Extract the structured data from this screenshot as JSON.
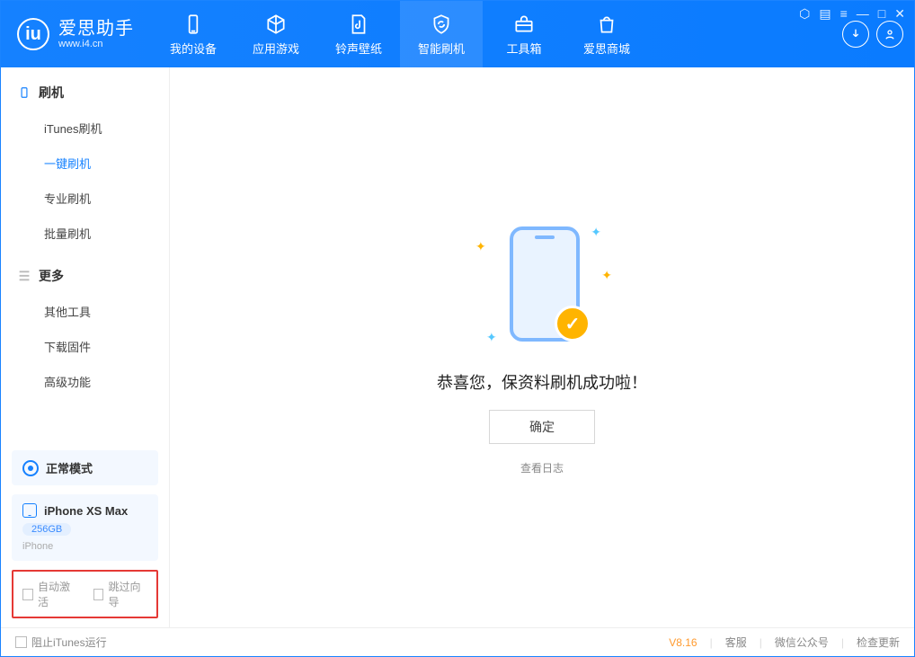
{
  "app": {
    "title": "爱思助手",
    "url": "www.i4.cn"
  },
  "header": {
    "tabs": [
      {
        "label": "我的设备"
      },
      {
        "label": "应用游戏"
      },
      {
        "label": "铃声壁纸"
      },
      {
        "label": "智能刷机"
      },
      {
        "label": "工具箱"
      },
      {
        "label": "爱思商城"
      }
    ]
  },
  "sidebar": {
    "section1": {
      "title": "刷机",
      "items": [
        "iTunes刷机",
        "一键刷机",
        "专业刷机",
        "批量刷机"
      ]
    },
    "section2": {
      "title": "更多",
      "items": [
        "其他工具",
        "下载固件",
        "高级功能"
      ]
    },
    "mode": "正常模式",
    "device": {
      "name": "iPhone XS Max",
      "capacity": "256GB",
      "type": "iPhone"
    },
    "checks": {
      "auto_activate": "自动激活",
      "skip_wizard": "跳过向导"
    }
  },
  "main": {
    "success_text": "恭喜您，保资料刷机成功啦！",
    "ok_label": "确定",
    "log_link": "查看日志"
  },
  "statusbar": {
    "block_itunes": "阻止iTunes运行",
    "version": "V8.16",
    "links": [
      "客服",
      "微信公众号",
      "检查更新"
    ]
  }
}
